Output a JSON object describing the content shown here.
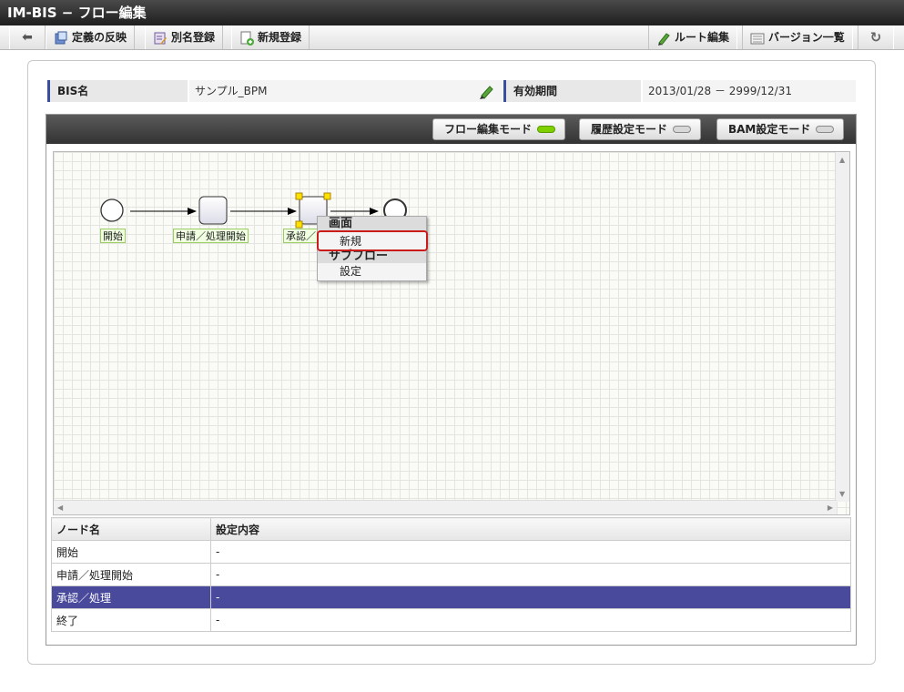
{
  "window": {
    "title": "IM-BIS − フロー編集"
  },
  "toolbar": {
    "back_icon": "arrow-left-icon",
    "apply_label": "定義の反映",
    "alias_label": "別名登録",
    "new_label": "新規登録",
    "route_label": "ルート編集",
    "version_label": "バージョン一覧",
    "refresh_icon": "refresh-icon"
  },
  "info": {
    "bis_name_label": "BIS名",
    "bis_name_value": "サンプル_BPM",
    "period_label": "有効期間",
    "period_value": "2013/01/28 － 2999/12/31"
  },
  "modes": {
    "flow_edit": "フロー編集モード",
    "history": "履歴設定モード",
    "bam": "BAM設定モード",
    "active_color": "#7fd000",
    "inactive_color": "#d8d8d8"
  },
  "flow": {
    "nodes": [
      {
        "label": "開始"
      },
      {
        "label": "申請／処理開始"
      },
      {
        "label": "承認／"
      }
    ]
  },
  "context_menu": {
    "screen_header": "画面",
    "new_item": "新規",
    "subflow_header": "サブフロー",
    "settings_item": "設定"
  },
  "table": {
    "columns": [
      "ノード名",
      "設定内容"
    ],
    "rows": [
      {
        "name": "開始",
        "value": "-"
      },
      {
        "name": "申請／処理開始",
        "value": "-"
      },
      {
        "name": "承認／処理",
        "value": "-"
      },
      {
        "name": "終了",
        "value": "-"
      }
    ],
    "selected_row": "承認／処理"
  }
}
